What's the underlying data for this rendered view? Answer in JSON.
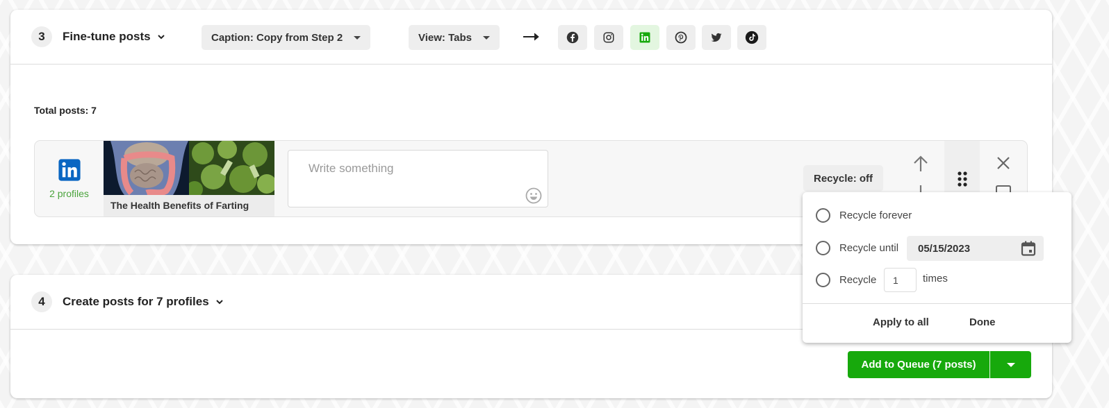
{
  "step3": {
    "number": "3",
    "title": "Fine-tune posts",
    "caption_dropdown": "Caption: Copy from Step 2",
    "view_dropdown": "View: Tabs",
    "networks": [
      {
        "name": "facebook",
        "icon": "facebook-icon",
        "active": false
      },
      {
        "name": "instagram",
        "icon": "instagram-icon",
        "active": false
      },
      {
        "name": "linkedin",
        "icon": "linkedin-icon",
        "active": true
      },
      {
        "name": "pinterest",
        "icon": "pinterest-icon",
        "active": false
      },
      {
        "name": "twitter",
        "icon": "twitter-icon",
        "active": false
      },
      {
        "name": "tiktok",
        "icon": "tiktok-icon",
        "active": false
      }
    ],
    "total_posts_label": "Total posts: 7",
    "post": {
      "network": "linkedin",
      "profiles": "2 profiles",
      "link_title": "The Health Benefits of Farting",
      "compose_placeholder": "Write something",
      "compose_value": "",
      "recycle_label": "Recycle: off"
    }
  },
  "recycle_popover": {
    "options": [
      {
        "label": "Recycle forever",
        "selected": false
      },
      {
        "label": "Recycle until",
        "selected": false
      },
      {
        "label": "Recycle",
        "selected": false
      }
    ],
    "until_date": "05/15/2023",
    "times_value": "1",
    "times_label": "times",
    "apply_all_label": "Apply to all",
    "done_label": "Done"
  },
  "step4": {
    "number": "4",
    "title": "Create posts for 7 profiles",
    "add_to_queue_label": "Add to Queue (7 posts)"
  },
  "colors": {
    "brand_green": "#17a90c",
    "linkedin_blue": "#0a66c2",
    "profiles_green": "#4aa33c",
    "active_network_bg": "#e3f6e0"
  }
}
